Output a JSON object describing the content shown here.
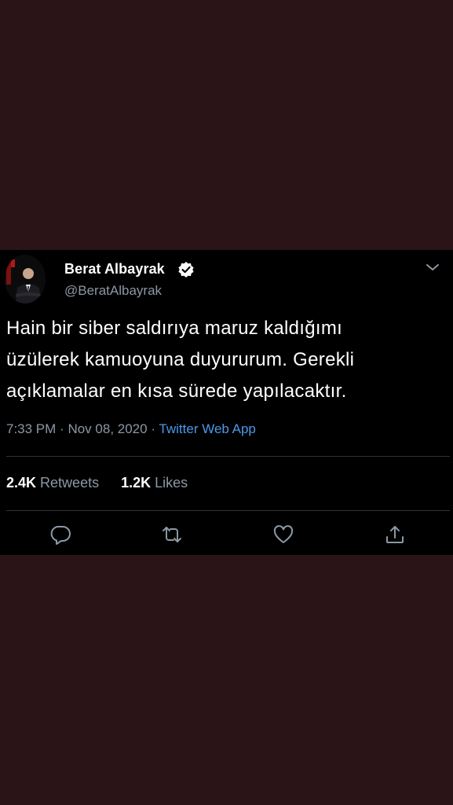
{
  "tweet": {
    "author": {
      "display_name": "Berat Albayrak",
      "handle": "@BeratAlbayrak",
      "verified": true
    },
    "text_lines": [
      "Hain bir siber saldırıya maruz kaldığımı",
      "üzülerek kamuoyuna duyururum. Gerekli",
      "açıklamalar en kısa sürede yapılacaktır."
    ],
    "time": "7:33 PM",
    "separator": "·",
    "date": "Nov 08, 2020",
    "source": "Twitter Web App",
    "stats": {
      "retweets_count": "2.4K",
      "retweets_label": "Retweets",
      "likes_count": "1.2K",
      "likes_label": "Likes"
    },
    "actions": [
      "reply-icon",
      "retweet-icon",
      "like-icon",
      "share-icon"
    ],
    "menu_icon": "chevron-down-icon"
  },
  "colors": {
    "background": "#2a1418",
    "card": "#000000",
    "text": "#ffffff",
    "secondary": "#8b98a5",
    "link": "#4a99e9",
    "divider": "#2f3336"
  }
}
